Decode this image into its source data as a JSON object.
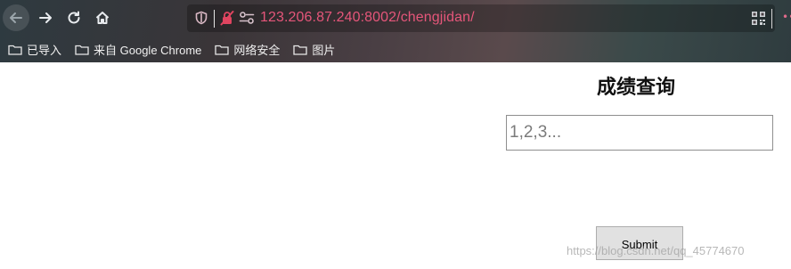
{
  "browser": {
    "address_bar": {
      "url": "123.206.87.240:8002/chengjidan/"
    },
    "bookmarks": [
      {
        "label": "已导入"
      },
      {
        "label": "来自 Google Chrome"
      },
      {
        "label": "网络安全"
      },
      {
        "label": "图片"
      }
    ],
    "accent_color": "#e5567a"
  },
  "page": {
    "title": "成绩查询",
    "query_input": {
      "value": "",
      "placeholder": "1,2,3..."
    },
    "submit_label": "Submit",
    "watermark": "https://blog.csdn.net/qq_45774670"
  }
}
